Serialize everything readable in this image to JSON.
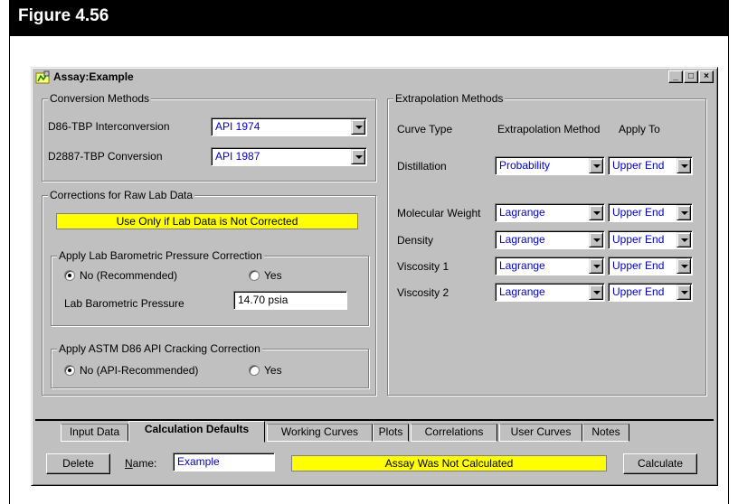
{
  "figure": {
    "title": "Figure 4.56"
  },
  "window": {
    "title": "Assay:Example",
    "controls": {
      "minimize": "_",
      "maximize": "□",
      "close": "×"
    }
  },
  "conversion": {
    "group_label": "Conversion Methods",
    "d86_label": "D86-TBP Interconversion",
    "d86_value": "API 1974",
    "d2887_label": "D2887-TBP Conversion",
    "d2887_value": "API 1987"
  },
  "corrections": {
    "group_label": "Corrections for Raw Lab Data",
    "warning": "Use Only if Lab Data is Not Corrected",
    "baro": {
      "group_label": "Apply Lab Barometric Pressure Correction",
      "no_label": "No (Recommended)",
      "yes_label": "Yes",
      "selected": "no",
      "pressure_label": "Lab Barometric Pressure",
      "pressure_value": "14.70 psia"
    },
    "astm": {
      "group_label": "Apply ASTM D86 API Cracking Correction",
      "no_label": "No (API-Recommended)",
      "yes_label": "Yes",
      "selected": "no"
    }
  },
  "extrapolation": {
    "group_label": "Extrapolation Methods",
    "headers": {
      "curve_type": "Curve Type",
      "method": "Extrapolation Method",
      "apply_to": "Apply To"
    },
    "rows": [
      {
        "curve": "Distillation",
        "method": "Probability",
        "apply": "Upper End"
      },
      {
        "curve": "Molecular Weight",
        "method": "Lagrange",
        "apply": "Upper End"
      },
      {
        "curve": "Density",
        "method": "Lagrange",
        "apply": "Upper End"
      },
      {
        "curve": "Viscosity 1",
        "method": "Lagrange",
        "apply": "Upper End"
      },
      {
        "curve": "Viscosity 2",
        "method": "Lagrange",
        "apply": "Upper End"
      }
    ]
  },
  "tabs": [
    {
      "label": "Input Data",
      "active": false
    },
    {
      "label": "Calculation Defaults",
      "active": true
    },
    {
      "label": "Working Curves",
      "active": false
    },
    {
      "label": "Plots",
      "active": false
    },
    {
      "label": "Correlations",
      "active": false
    },
    {
      "label": "User Curves",
      "active": false
    },
    {
      "label": "Notes",
      "active": false
    }
  ],
  "footer": {
    "delete_label": "Delete",
    "name_label": "Name:",
    "name_value": "Example",
    "status": "Assay Was Not Calculated",
    "calculate_label": "Calculate"
  },
  "colors": {
    "warning_bg": "#ffff00",
    "value_text": "#0000c8",
    "window_bg": "#c0c0c0"
  }
}
